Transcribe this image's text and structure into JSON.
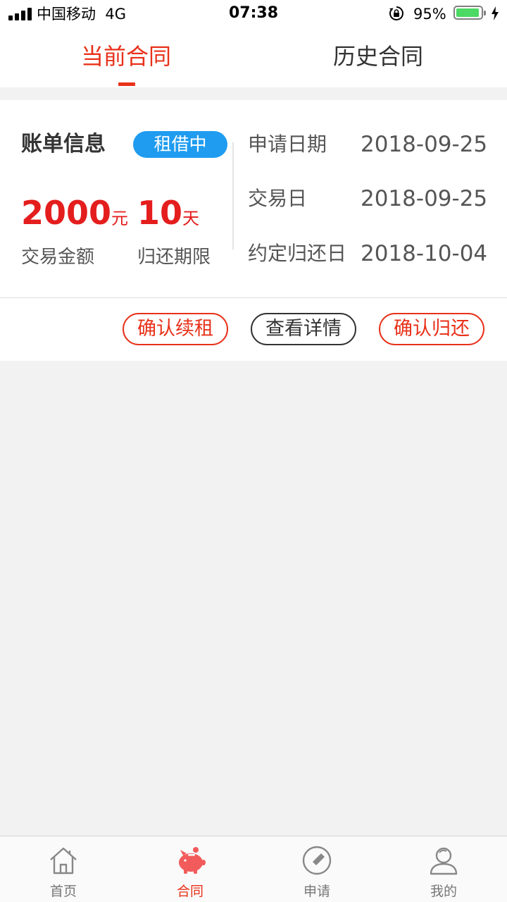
{
  "status_bar": {
    "carrier": "中国移动",
    "network": "4G",
    "time": "07:38",
    "battery": "95%",
    "battery_level": 0.95,
    "battery_color": "#4cd964"
  },
  "tabs": [
    {
      "label": "当前合同",
      "active": true
    },
    {
      "label": "历史合同",
      "active": false
    }
  ],
  "card": {
    "title": "账单信息",
    "status_badge": "租借中",
    "amount": "2000",
    "amount_unit": "元",
    "amount_label": "交易金额",
    "term": "10",
    "term_unit": "天",
    "term_label": "归还期限",
    "dates": [
      {
        "label": "申请日期",
        "value": "2018-09-25"
      },
      {
        "label": "交易日",
        "value": "2018-09-25"
      },
      {
        "label": "约定归还日",
        "value": "2018-10-04"
      }
    ],
    "actions": {
      "renew": "确认续租",
      "detail": "查看详情",
      "return": "确认归还"
    }
  },
  "bottom_nav": [
    {
      "label": "首页",
      "icon": "home-icon",
      "active": false
    },
    {
      "label": "合同",
      "icon": "piggy-bank-icon",
      "active": true
    },
    {
      "label": "申请",
      "icon": "pencil-circle-icon",
      "active": false
    },
    {
      "label": "我的",
      "icon": "user-icon",
      "active": false
    }
  ],
  "colors": {
    "accent": "#e8311a",
    "badge": "#1f9cf0",
    "amount": "#e41d1d"
  }
}
